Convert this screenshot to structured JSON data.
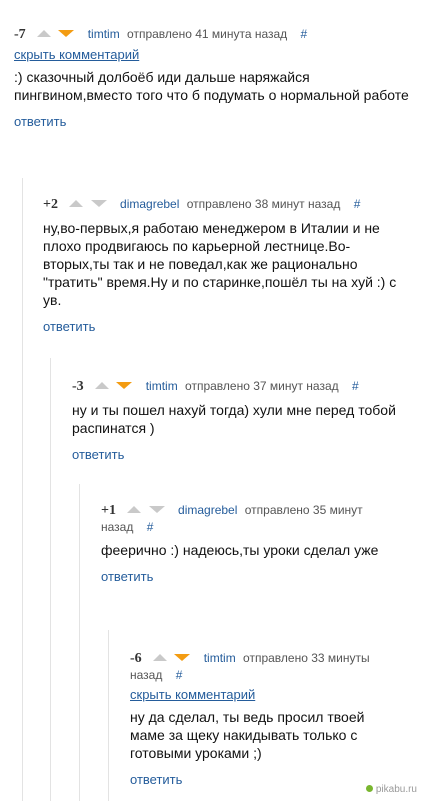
{
  "comments": [
    {
      "score": "-7",
      "author": "timtim",
      "time": "отправлено 41 минута назад",
      "hash": "#",
      "hide": "скрыть комментарий",
      "text": ":) сказочный долбоёб иди дальше наряжайся пингвином,вместо того что б подумать о нормальной работе",
      "reply": "ответить",
      "vote": "down"
    },
    {
      "score": "+2",
      "author": "dimagrebel",
      "time": "отправлено 38 минут назад",
      "hash": "#",
      "text": "ну,во-первых,я работаю менеджером в Италии и не плохо продвигаюсь по карьерной лестнице.Во-вторых,ты так и не поведал,как же рационально \"тратить\" время.Ну и по старинке,пошёл ты на хуй :) с ув.",
      "reply": "ответить",
      "vote": "none"
    },
    {
      "score": "-3",
      "author": "timtim",
      "time": "отправлено 37 минут назад",
      "hash": "#",
      "text": "ну и ты пошел нахуй тогда) хули мне перед тобой распинатся )",
      "reply": "ответить",
      "vote": "down"
    },
    {
      "score": "+1",
      "author": "dimagrebel",
      "time": "отправлено 35 минут назад",
      "hash": "#",
      "text": "феерично :) надеюсь,ты уроки сделал уже",
      "reply": "ответить",
      "vote": "none"
    },
    {
      "score": "-6",
      "author": "timtim",
      "time": "отправлено 33 минуты назад",
      "hash": "#",
      "hide": "скрыть комментарий",
      "text": "ну да сделал, ты ведь просил твоей маме за щеку накидывать только с готовыми уроками ;)",
      "reply": "ответить",
      "vote": "down"
    }
  ],
  "watermark": "pikabu.ru",
  "colors": {
    "link": "#245c9b",
    "vote_down_active": "#f39c12",
    "vote_inactive": "#c9c9c9"
  }
}
